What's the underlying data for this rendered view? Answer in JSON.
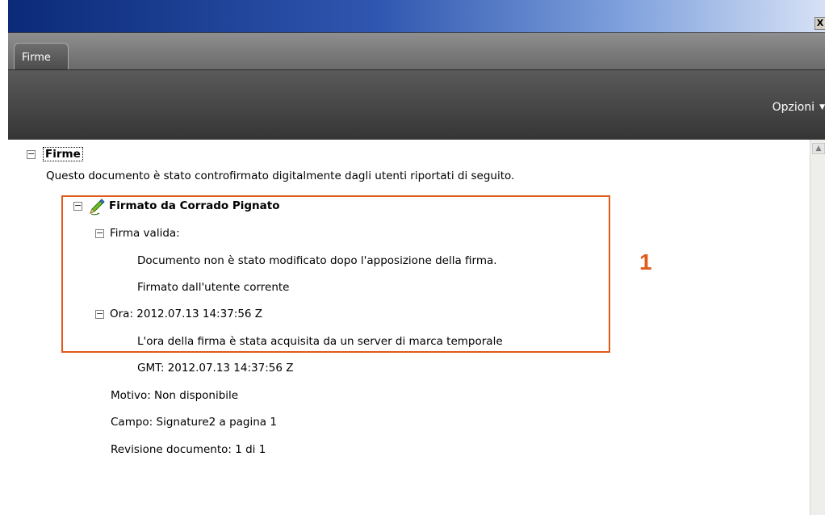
{
  "window": {
    "close_label": "X"
  },
  "tabs": [
    {
      "label": "Firme"
    }
  ],
  "toolbar": {
    "options_label": "Opzioni",
    "options_caret": "▼"
  },
  "tree": {
    "toggle_glyph": "−",
    "root_label": "Firme",
    "description": "Questo documento è stato controfirmato digitalmente dagli utenti riportati di seguito.",
    "signature": {
      "label": "Firmato da Corrado Pignato",
      "icon": "signature-pen-icon",
      "validity_label": "Firma valida:",
      "validity_details": [
        "Documento non è stato modificato dopo l'apposizione della firma.",
        "Firmato dall'utente corrente"
      ],
      "time_label": "Ora: 2012.07.13 14:37:56 Z",
      "time_details": [
        "L'ora della firma è stata acquisita da un server di marca temporale",
        "GMT: 2012.07.13 14:37:56 Z"
      ],
      "reason": "Motivo: Non disponibile",
      "field": "Campo: Signature2 a pagina 1",
      "revision": "Revisione documento: 1 di 1"
    }
  },
  "annotation": {
    "label": "1",
    "color": "#e05a1a"
  },
  "scrollbar": {
    "up_glyph": "▲"
  }
}
